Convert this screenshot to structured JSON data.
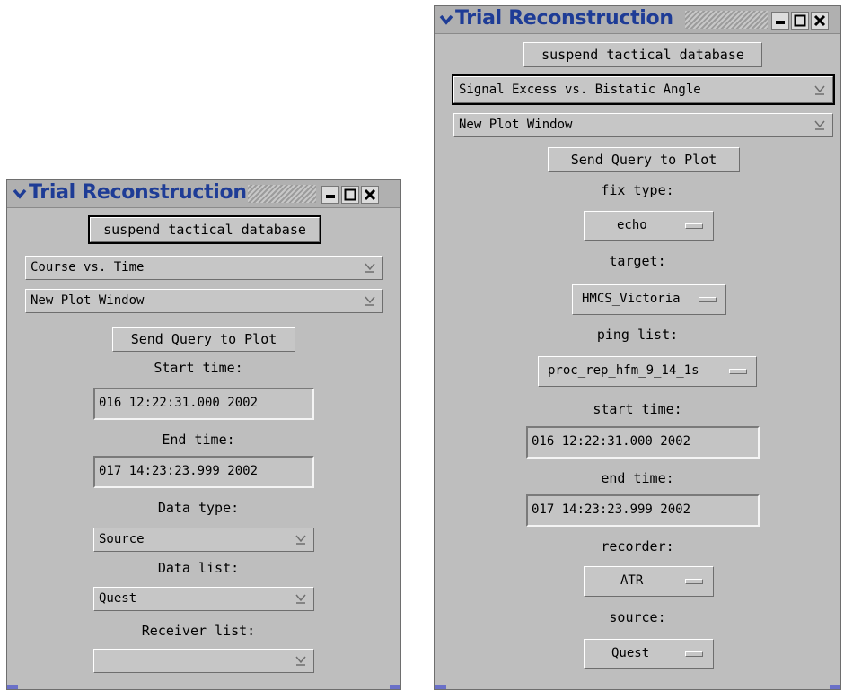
{
  "windowA": {
    "title": "Trial Reconstruction",
    "suspend_label": "suspend tactical database",
    "plot_type": "Course vs. Time",
    "plot_target": "New Plot Window",
    "send_label": "Send Query to Plot",
    "start_label": "Start time:",
    "start_value": "016 12:22:31.000 2002",
    "end_label": "End time:",
    "end_value": "017 14:23:23.999 2002",
    "data_type_label": "Data type:",
    "data_type_value": "Source",
    "data_list_label": "Data list:",
    "data_list_value": "Quest",
    "receiver_label": "Receiver list:",
    "receiver_value": ""
  },
  "windowB": {
    "title": "Trial Reconstruction",
    "suspend_label": "suspend tactical database",
    "plot_type": "Signal Excess vs. Bistatic Angle",
    "plot_target": "New Plot Window",
    "send_label": "Send Query to Plot",
    "fix_type_label": "fix type:",
    "fix_type_value": "echo",
    "target_label": "target:",
    "target_value": "HMCS_Victoria",
    "ping_label": "ping list:",
    "ping_value": "proc_rep_hfm_9_14_1s",
    "start_label": "start time:",
    "start_value": "016 12:22:31.000 2002",
    "end_label": "end time:",
    "end_value": "017 14:23:23.999 2002",
    "recorder_label": "recorder:",
    "recorder_value": "ATR",
    "source_label": "source:",
    "source_value": "Quest"
  },
  "colors": {
    "window_bg": "#bebebe",
    "title_text": "#1e3c96",
    "panel_accent": "#6a70c8"
  },
  "icons": [
    "window-menu-chevron-icon",
    "minimize-icon",
    "maximize-icon",
    "close-icon",
    "dropdown-arrow-icon",
    "text-cursor-icon"
  ]
}
